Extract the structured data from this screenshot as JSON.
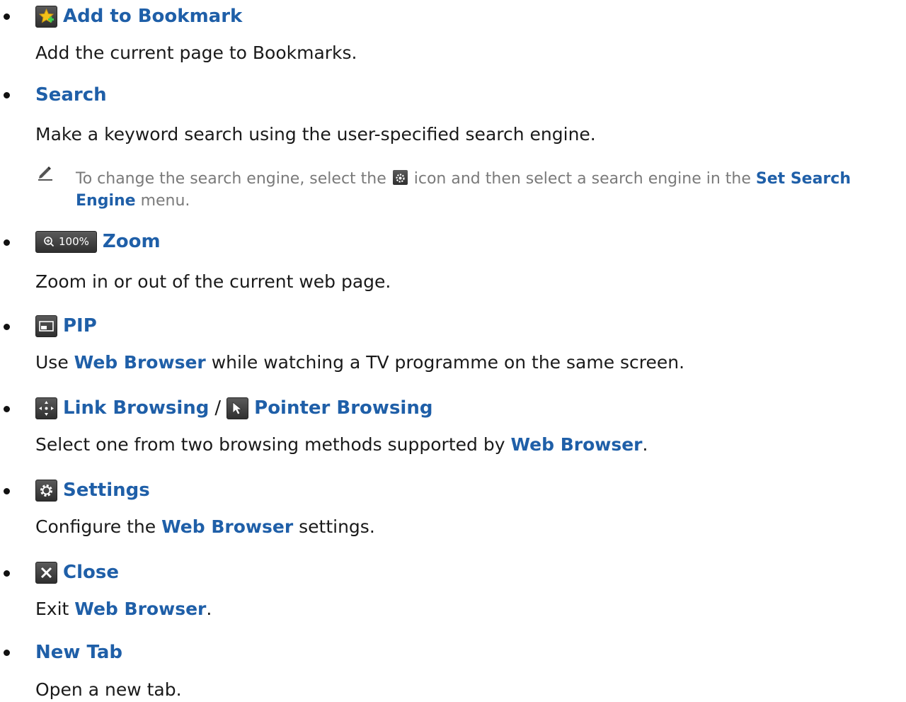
{
  "items": [
    {
      "icon": "bookmark-star-icon",
      "title": "Add to Bookmark",
      "desc": "Add the current page to Bookmarks."
    },
    {
      "title": "Search",
      "desc": "Make a keyword search using the user-specified search engine.",
      "note": {
        "before": "To change the search engine, select the",
        "icon": "gear-icon",
        "after": "icon and then select a search engine in the",
        "link": "Set Search Engine",
        "end": "menu."
      }
    },
    {
      "icon": "zoom-icon",
      "icon_text": "100%",
      "title": "Zoom",
      "desc": "Zoom in or out of the current web page."
    },
    {
      "icon": "pip-icon",
      "title": "PIP",
      "desc_before": "Use",
      "desc_link": "Web Browser",
      "desc_after": "while watching a TV programme on the same screen."
    },
    {
      "icon": "link-browsing-icon",
      "title": "Link Browsing",
      "separator": "/",
      "icon2": "pointer-icon",
      "title2": "Pointer Browsing",
      "desc_before": "Select one from two browsing methods supported by",
      "desc_link": "Web Browser",
      "desc_after": "."
    },
    {
      "icon": "gear-icon",
      "title": "Settings",
      "desc_before": "Configure the",
      "desc_link": "Web Browser",
      "desc_after": "settings."
    },
    {
      "icon": "close-icon",
      "title": "Close",
      "desc_before": "Exit",
      "desc_link": "Web Browser",
      "desc_after": "."
    },
    {
      "title": "New Tab",
      "desc": "Open a new tab."
    }
  ],
  "colors": {
    "link": "#1f5fa8",
    "text": "#1a1a1a",
    "note": "#7a7a7a"
  }
}
